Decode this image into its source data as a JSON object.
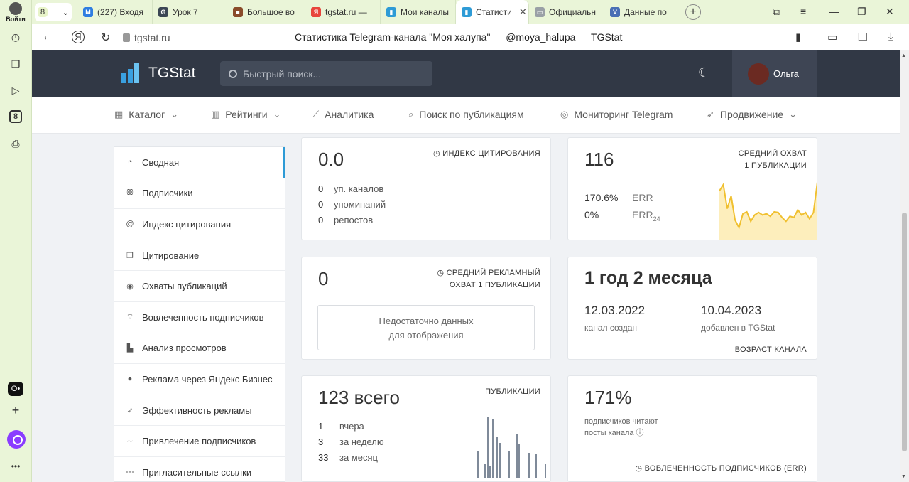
{
  "rail": {
    "login": "Войти",
    "badge": "8",
    "dark_label": "O•"
  },
  "tabs": [
    {
      "label": "(227) Входя",
      "color": "#2f7de1",
      "icon": "M"
    },
    {
      "label": "Урок 7",
      "color": "#3b4654",
      "icon": "G"
    },
    {
      "label": "Большое во",
      "color": "#8a4b2a",
      "icon": "■"
    },
    {
      "label": "tgstat.ru — ",
      "color": "#e8453c",
      "icon": "Я"
    },
    {
      "label": "Мои каналы",
      "color": "#2e9bd6",
      "icon": "▮"
    },
    {
      "label": "Статисти",
      "color": "#2e9bd6",
      "icon": "▮",
      "active": true
    },
    {
      "label": "Официальн",
      "color": "#9aa0a6",
      "icon": "▭"
    },
    {
      "label": "Данные по ",
      "color": "#4a6fb5",
      "icon": "V"
    }
  ],
  "tabcount": "8",
  "address": {
    "url": "tgstat.ru",
    "title": "Статистика Telegram-канала \"Моя халупа\" — @moya_halupa — TGStat"
  },
  "site": {
    "logo": "TGStat",
    "search_placeholder": "Быстрый поиск...",
    "user": "Ольга"
  },
  "nav": [
    {
      "label": "Каталог",
      "icon": "▦",
      "dropdown": true
    },
    {
      "label": "Рейтинги",
      "icon": "▥",
      "dropdown": true
    },
    {
      "label": "Аналитика",
      "icon": "⟋",
      "dropdown": false
    },
    {
      "label": "Поиск по публикациям",
      "icon": "⌕",
      "dropdown": false
    },
    {
      "label": "Мониторинг Telegram",
      "icon": "◎",
      "dropdown": false
    },
    {
      "label": "Продвижение",
      "icon": "➶",
      "dropdown": true
    }
  ],
  "sidebar": [
    {
      "label": "Сводная",
      "icon": "◔",
      "active": true
    },
    {
      "label": "Подписчики",
      "icon": "ꕥ"
    },
    {
      "label": "Индекс цитирования",
      "icon": "@"
    },
    {
      "label": "Цитирование",
      "icon": "❐"
    },
    {
      "label": "Охваты публикаций",
      "icon": "◉"
    },
    {
      "label": "Вовлеченность подписчиков",
      "icon": "⌔"
    },
    {
      "label": "Анализ просмотров",
      "icon": "▙"
    },
    {
      "label": "Реклама через Яндекс Бизнес",
      "icon": "●"
    },
    {
      "label": "Эффективность рекламы",
      "icon": "➶"
    },
    {
      "label": "Привлечение подписчиков",
      "icon": "∼"
    },
    {
      "label": "Пригласительные ссылки",
      "icon": "⚯"
    }
  ],
  "citation": {
    "value": "0.0",
    "title": "ИНДЕКС ЦИТИРОВАНИЯ",
    "rows": [
      {
        "n": "0",
        "t": "уп. каналов"
      },
      {
        "n": "0",
        "t": "упоминаний"
      },
      {
        "n": "0",
        "t": "репостов"
      }
    ]
  },
  "reach": {
    "value": "116",
    "title1": "СРЕДНИЙ ОХВАТ",
    "title2": "1 ПУБЛИКАЦИИ",
    "err": "170.6%",
    "err_label": "ERR",
    "err24": "0%",
    "err24_label": "ERR",
    "err24_sub": "24",
    "spark": [
      78,
      88,
      50,
      70,
      32,
      20,
      42,
      45,
      30,
      40,
      44,
      40,
      42,
      38,
      45,
      44,
      36,
      30,
      38,
      36,
      48,
      40,
      44,
      34,
      44,
      92
    ]
  },
  "ad_reach": {
    "value": "0",
    "title1": "СРЕДНИЙ РЕКЛАМНЫЙ",
    "title2": "ОХВАТ 1 ПУБЛИКАЦИИ",
    "nodata1": "Недостаточно данных",
    "nodata2": "для отображения"
  },
  "age": {
    "value": "1 год 2 месяца",
    "created": "12.03.2022",
    "created_label": "канал создан",
    "added": "10.04.2023",
    "added_label": "добавлен в TGStat",
    "title": "ВОЗРАСТ КАНАЛА"
  },
  "posts": {
    "value": "123 всего",
    "title": "ПУБЛИКАЦИИ",
    "rows": [
      {
        "n": "1",
        "t": "вчера"
      },
      {
        "n": "3",
        "t": "за неделю"
      },
      {
        "n": "33",
        "t": "за месяц"
      }
    ],
    "bars": [
      0,
      0,
      0,
      0,
      0,
      0,
      0,
      0,
      38,
      0,
      0,
      20,
      86,
      18,
      84,
      0,
      58,
      50,
      0,
      0,
      0,
      38,
      0,
      0,
      62,
      48,
      0,
      0,
      0,
      36,
      0,
      0,
      34,
      0,
      0,
      0,
      20
    ]
  },
  "er": {
    "value": "171%",
    "line1": "подписчиков читают",
    "line2": "посты канала",
    "title": "ВОВЛЕЧЕННОСТЬ ПОДПИСЧИКОВ (ERR)"
  }
}
